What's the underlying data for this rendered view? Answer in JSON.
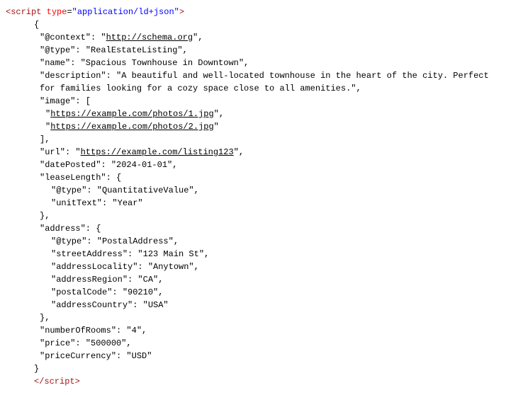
{
  "lines": [
    {
      "level": "level1",
      "parts": [
        {
          "t": "<",
          "c": "tag"
        },
        {
          "t": "script",
          "c": "tag"
        },
        {
          "t": " ",
          "c": ""
        },
        {
          "t": "type",
          "c": "attr-name"
        },
        {
          "t": "=",
          "c": "punct"
        },
        {
          "t": "\"application/ld+json\"",
          "c": "attr-value"
        },
        {
          "t": ">",
          "c": "tag"
        }
      ]
    },
    {
      "level": "level2",
      "parts": [
        {
          "t": "{",
          "c": ""
        }
      ]
    },
    {
      "level": "level3",
      "parts": [
        {
          "t": "\"@context\": \"",
          "c": ""
        },
        {
          "t": "http://schema.org",
          "c": "link"
        },
        {
          "t": "\",",
          "c": ""
        }
      ]
    },
    {
      "level": "level3",
      "parts": [
        {
          "t": "\"@type\": \"RealEstateListing\",",
          "c": ""
        }
      ]
    },
    {
      "level": "level3",
      "parts": [
        {
          "t": "\"name\": \"Spacious Townhouse in Downtown\",",
          "c": ""
        }
      ]
    },
    {
      "level": "level3",
      "parts": [
        {
          "t": "\"description\": \"A beautiful and well-located townhouse in the heart of the city. Perfect",
          "c": ""
        }
      ]
    },
    {
      "level": "wrap1",
      "parts": [
        {
          "t": "for families looking for a cozy space close to all amenities.\",",
          "c": ""
        }
      ]
    },
    {
      "level": "level3",
      "parts": [
        {
          "t": "\"image\": [",
          "c": ""
        }
      ]
    },
    {
      "level": "level4",
      "parts": [
        {
          "t": "\"",
          "c": ""
        },
        {
          "t": "https://example.com/photos/1.jpg",
          "c": "link"
        },
        {
          "t": "\",",
          "c": ""
        }
      ]
    },
    {
      "level": "level4",
      "parts": [
        {
          "t": "\"",
          "c": ""
        },
        {
          "t": "https://example.com/photos/2.jpg",
          "c": "link"
        },
        {
          "t": "\"",
          "c": ""
        }
      ]
    },
    {
      "level": "level3",
      "parts": [
        {
          "t": "],",
          "c": ""
        }
      ]
    },
    {
      "level": "level3",
      "parts": [
        {
          "t": "\"url\": \"",
          "c": ""
        },
        {
          "t": "https://example.com/listing123",
          "c": "link"
        },
        {
          "t": "\",",
          "c": ""
        }
      ]
    },
    {
      "level": "level3",
      "parts": [
        {
          "t": "\"datePosted\": \"2024-01-01\",",
          "c": ""
        }
      ]
    },
    {
      "level": "level3",
      "parts": [
        {
          "t": "\"leaseLength\": {",
          "c": ""
        }
      ]
    },
    {
      "level": "level5",
      "parts": [
        {
          "t": "\"@type\": \"QuantitativeValue\",",
          "c": ""
        }
      ]
    },
    {
      "level": "level5",
      "parts": [
        {
          "t": "\"unitText\": \"Year\"",
          "c": ""
        }
      ]
    },
    {
      "level": "level3",
      "parts": [
        {
          "t": "},",
          "c": ""
        }
      ]
    },
    {
      "level": "level3",
      "parts": [
        {
          "t": "\"address\": {",
          "c": ""
        }
      ]
    },
    {
      "level": "level5",
      "parts": [
        {
          "t": "\"@type\": \"PostalAddress\",",
          "c": ""
        }
      ]
    },
    {
      "level": "level5",
      "parts": [
        {
          "t": "\"streetAddress\": \"123 Main St\",",
          "c": ""
        }
      ]
    },
    {
      "level": "level5",
      "parts": [
        {
          "t": "\"addressLocality\": \"Anytown\",",
          "c": ""
        }
      ]
    },
    {
      "level": "level5",
      "parts": [
        {
          "t": "\"addressRegion\": \"CA\",",
          "c": ""
        }
      ]
    },
    {
      "level": "level5",
      "parts": [
        {
          "t": "\"postalCode\": \"90210\",",
          "c": ""
        }
      ]
    },
    {
      "level": "level5",
      "parts": [
        {
          "t": "\"addressCountry\": \"USA\"",
          "c": ""
        }
      ]
    },
    {
      "level": "level3",
      "parts": [
        {
          "t": "},",
          "c": ""
        }
      ]
    },
    {
      "level": "level3",
      "parts": [
        {
          "t": "\"numberOfRooms\": \"4\",",
          "c": ""
        }
      ]
    },
    {
      "level": "level3",
      "parts": [
        {
          "t": "\"price\": \"500000\",",
          "c": ""
        }
      ]
    },
    {
      "level": "level3",
      "parts": [
        {
          "t": "\"priceCurrency\": \"USD\"",
          "c": ""
        }
      ]
    },
    {
      "level": "level2",
      "parts": [
        {
          "t": "}",
          "c": ""
        }
      ]
    },
    {
      "level": "level2",
      "parts": [
        {
          "t": "</",
          "c": "tag"
        },
        {
          "t": "script",
          "c": "tag"
        },
        {
          "t": ">",
          "c": "tag"
        }
      ]
    }
  ]
}
